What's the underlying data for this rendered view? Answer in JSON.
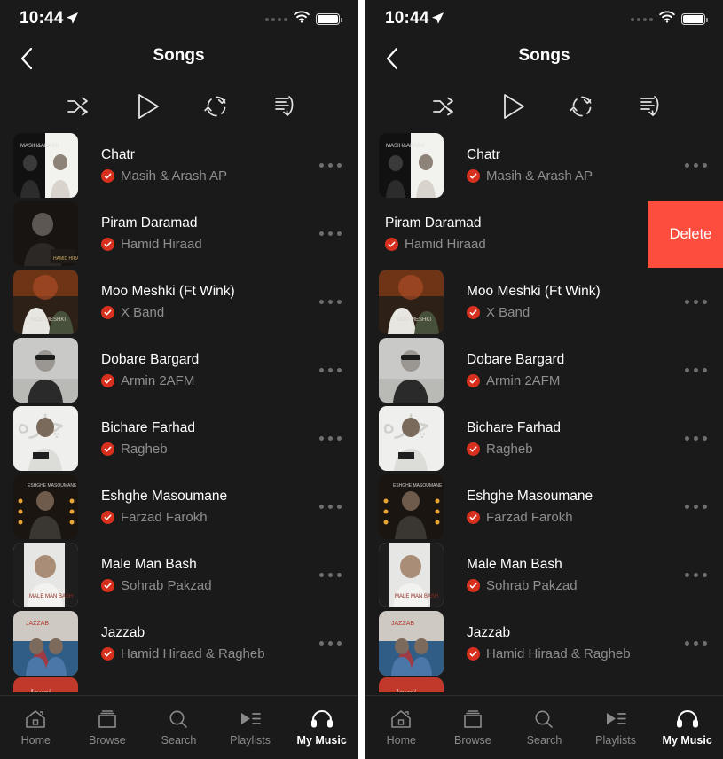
{
  "status_bar": {
    "time": "10:44",
    "location_icon": "location-arrow-icon",
    "signal_icon": "signal-dots-icon",
    "wifi_icon": "wifi-icon",
    "battery_icon": "battery-full-icon"
  },
  "nav": {
    "back_icon": "chevron-left-icon",
    "title": "Songs"
  },
  "controls": [
    {
      "name": "shuffle-button",
      "icon": "shuffle-icon"
    },
    {
      "name": "play-button",
      "icon": "play-icon"
    },
    {
      "name": "repeat-button",
      "icon": "repeat-icon"
    },
    {
      "name": "sort-queue-button",
      "icon": "sort-queue-icon"
    }
  ],
  "songs": [
    {
      "title": "Chatr",
      "artist": "Masih & Arash AP",
      "verified": true,
      "menu_icon": "more-options-icon"
    },
    {
      "title": "Piram Daramad",
      "artist": "Hamid Hiraad",
      "verified": true,
      "menu_icon": "more-options-icon"
    },
    {
      "title": "Moo Meshki (Ft Wink)",
      "artist": "X Band",
      "verified": true,
      "menu_icon": "more-options-icon"
    },
    {
      "title": "Dobare Bargard",
      "artist": "Armin 2AFM",
      "verified": true,
      "menu_icon": "more-options-icon"
    },
    {
      "title": "Bichare Farhad",
      "artist": "Ragheb",
      "verified": true,
      "menu_icon": "more-options-icon"
    },
    {
      "title": "Eshghe Masoumane",
      "artist": "Farzad Farokh",
      "verified": true,
      "menu_icon": "more-options-icon"
    },
    {
      "title": "Male Man Bash",
      "artist": "Sohrab Pakzad",
      "verified": true,
      "menu_icon": "more-options-icon"
    },
    {
      "title": "Jazzab",
      "artist": "Hamid Hiraad & Ragheb",
      "verified": true,
      "menu_icon": "more-options-icon"
    }
  ],
  "swipe": {
    "delete_label": "Delete",
    "swiped_song_index": 1
  },
  "tabs": [
    {
      "label": "Home",
      "icon": "home-icon",
      "active": false
    },
    {
      "label": "Browse",
      "icon": "browse-icon",
      "active": false
    },
    {
      "label": "Search",
      "icon": "search-icon",
      "active": false
    },
    {
      "label": "Playlists",
      "icon": "playlists-icon",
      "active": false
    },
    {
      "label": "My Music",
      "icon": "headphones-icon",
      "active": true
    }
  ],
  "colors": {
    "background": "#1a1a1a",
    "delete_red": "#fd4d3f",
    "verified_red": "#d8301f",
    "primary_text": "#ffffff",
    "secondary_text": "#8e8e8e"
  }
}
